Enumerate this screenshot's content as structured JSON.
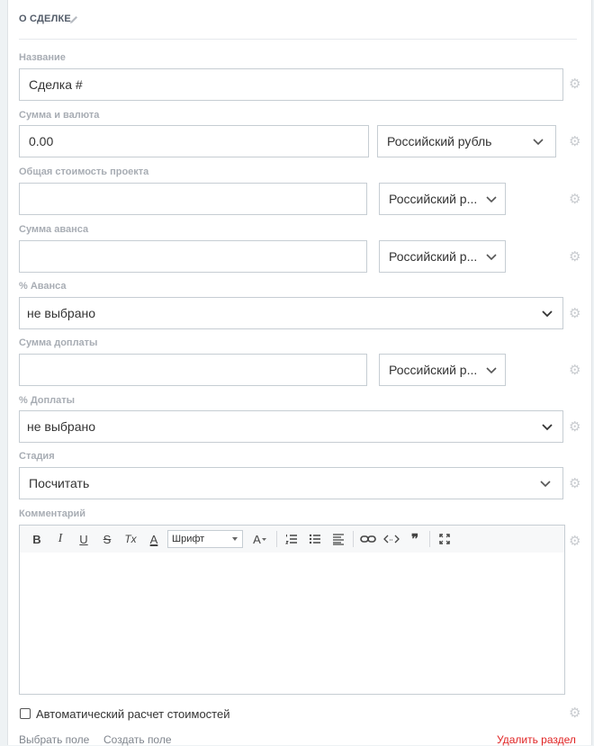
{
  "section": {
    "title": "О СДЕЛКЕ"
  },
  "fields": {
    "name": {
      "label": "Название",
      "value": "Сделка #"
    },
    "amount": {
      "label": "Сумма и валюта",
      "value": "0.00",
      "currency": "Российский рубль"
    },
    "total_cost": {
      "label": "Общая стоимость проекта",
      "value": "",
      "currency": "Российский р..."
    },
    "advance_sum": {
      "label": "Сумма аванса",
      "value": "",
      "currency": "Российский р..."
    },
    "advance_pct": {
      "label": "% Аванса",
      "value": "не выбрано"
    },
    "surcharge_sum": {
      "label": "Сумма доплаты",
      "value": "",
      "currency": "Российский р..."
    },
    "surcharge_pct": {
      "label": "% Доплаты",
      "value": "не выбрано"
    },
    "stage": {
      "label": "Стадия",
      "value": "Посчитать"
    },
    "comment": {
      "label": "Комментарий",
      "value": ""
    }
  },
  "editor_toolbar": {
    "bold": "B",
    "italic": "I",
    "underline": "U",
    "strike": "S",
    "clear_format": "Tx",
    "font_color": "A",
    "font_select": "Шрифт",
    "font_size": "A"
  },
  "auto_calc": {
    "label": "Автоматический расчет стоимостей",
    "checked": false
  },
  "footer": {
    "select_field": "Выбрать поле",
    "create_field": "Создать поле",
    "delete_section": "Удалить раздел"
  },
  "colors": {
    "accent_red": "#e02424",
    "label_gray": "#a8adb4",
    "border": "#c6cdd3"
  }
}
